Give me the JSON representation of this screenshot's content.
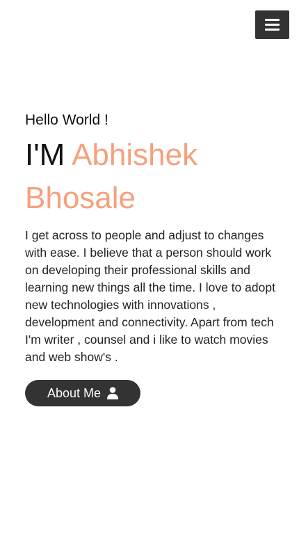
{
  "header": {
    "menu_icon": "hamburger-menu-icon"
  },
  "hero": {
    "greeting": "Hello World !",
    "prefix": "I'M",
    "first_name": "Abhishek",
    "last_name": "Bhosale",
    "bio": "I get across to people and adjust to changes with ease. I believe that a person should work on developing their professional skills and learning new things all the time.  I love to adopt new technologies with innovations , development and connectivity. Apart from tech I'm writer , counsel and i like to watch movies and web show's .",
    "about_button_label": "About Me",
    "about_button_icon": "user-icon"
  },
  "colors": {
    "accent": "#f6a07e",
    "dark": "#333333",
    "background": "#ffffff"
  }
}
